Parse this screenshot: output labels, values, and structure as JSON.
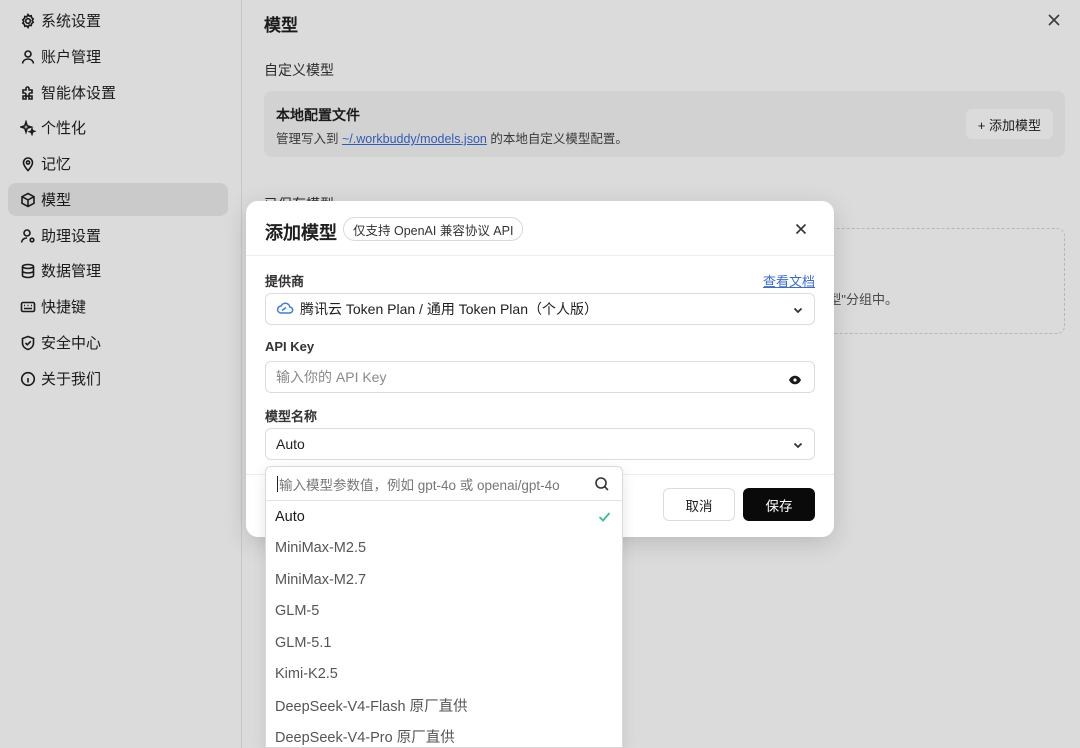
{
  "sidebar": {
    "items": [
      {
        "label": "系统设置",
        "icon": "gear-icon"
      },
      {
        "label": "账户管理",
        "icon": "user-icon"
      },
      {
        "label": "智能体设置",
        "icon": "puzzle-icon"
      },
      {
        "label": "个性化",
        "icon": "sparkle-icon"
      },
      {
        "label": "记忆",
        "icon": "location-pin-icon"
      },
      {
        "label": "模型",
        "icon": "cube-icon",
        "active": true
      },
      {
        "label": "助理设置",
        "icon": "user-settings-icon"
      },
      {
        "label": "数据管理",
        "icon": "database-icon"
      },
      {
        "label": "快捷键",
        "icon": "keyboard-icon"
      },
      {
        "label": "安全中心",
        "icon": "shield-icon"
      },
      {
        "label": "关于我们",
        "icon": "info-icon"
      }
    ]
  },
  "main": {
    "title": "模型",
    "custom_section": "自定义模型",
    "local_config": {
      "title": "本地配置文件",
      "desc_prefix": "管理写入到 ",
      "path": "~/.workbuddy/models.json",
      "desc_suffix": " 的本地自定义模型配置。",
      "add_button": "+ 添加模型"
    },
    "section2_partial": "已保存模型",
    "dashed_text": "型\"分组中。"
  },
  "modal": {
    "title": "添加模型",
    "badge": "仅支持 OpenAI 兼容协议 API",
    "provider_label": "提供商",
    "doc_link": "查看文档",
    "provider_value": "腾讯云 Token Plan / 通用 Token Plan（个人版）",
    "apikey_label": "API Key",
    "apikey_placeholder": "输入你的 API Key",
    "model_label": "模型名称",
    "model_value": "Auto",
    "cancel": "取消",
    "save": "保存"
  },
  "dropdown": {
    "search_placeholder": "输入模型参数值，例如 gpt-4o 或 openai/gpt-4o",
    "options": [
      {
        "label": "Auto",
        "selected": true
      },
      {
        "label": "MiniMax-M2.5"
      },
      {
        "label": "MiniMax-M2.7"
      },
      {
        "label": "GLM-5"
      },
      {
        "label": "GLM-5.1"
      },
      {
        "label": "Kimi-K2.5"
      },
      {
        "label": "DeepSeek-V4-Flash 原厂直供"
      },
      {
        "label": "DeepSeek-V4-Pro 原厂直供"
      }
    ]
  },
  "colors": {
    "accent_link": "#3b6bd6",
    "check": "#3cbf8a",
    "save_button": "#0a0a0a"
  }
}
